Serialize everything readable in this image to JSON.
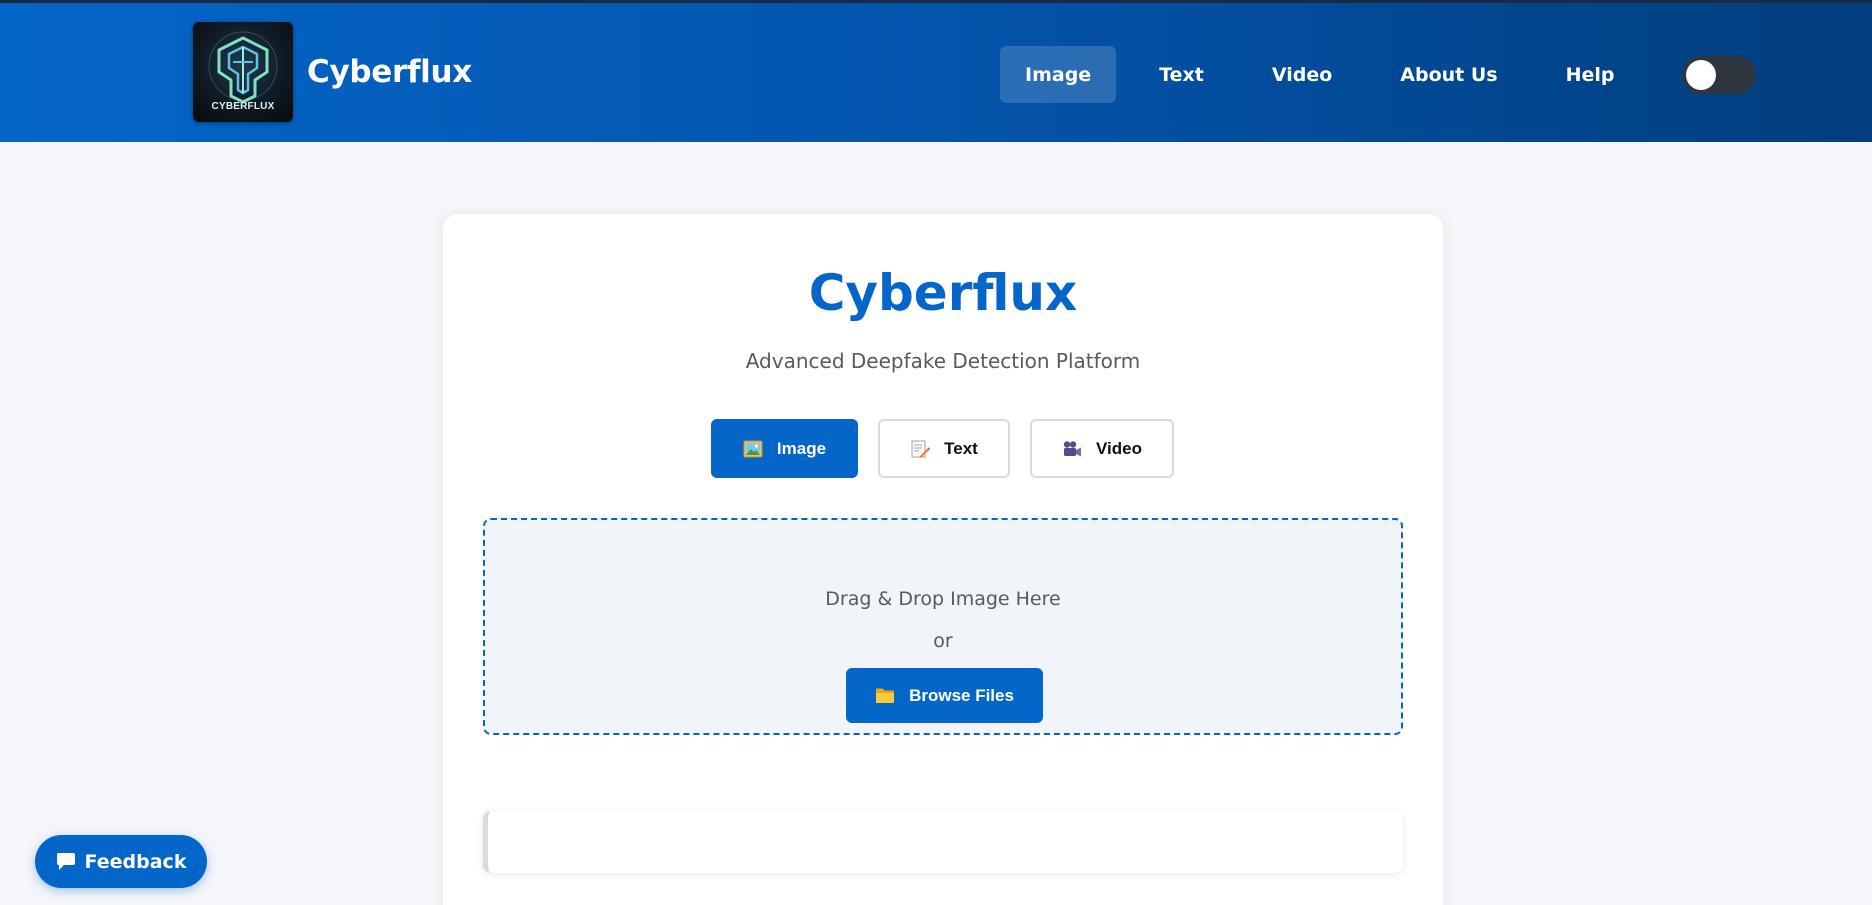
{
  "header": {
    "logo_text": "CYBERFLUX",
    "brand_name": "Cyberflux",
    "nav": [
      {
        "label": "Image",
        "active": true
      },
      {
        "label": "Text",
        "active": false
      },
      {
        "label": "Video",
        "active": false
      },
      {
        "label": "About Us",
        "active": false
      },
      {
        "label": "Help",
        "active": false
      }
    ],
    "theme_toggle": {
      "on": false
    }
  },
  "main": {
    "title": "Cyberflux",
    "subtitle": "Advanced Deepfake Detection Platform",
    "tabs": [
      {
        "label": "Image",
        "icon": "picture-icon",
        "active": true
      },
      {
        "label": "Text",
        "icon": "memo-icon",
        "active": false
      },
      {
        "label": "Video",
        "icon": "movie-camera-icon",
        "active": false
      }
    ],
    "dropzone": {
      "text": "Drag & Drop Image Here",
      "or": "or",
      "browse_label": "Browse Files",
      "browse_icon": "folder-icon"
    }
  },
  "feedback": {
    "label": "Feedback",
    "icon": "speech-bubble-icon"
  },
  "colors": {
    "primary": "#0466c8",
    "header_end": "#023e7d",
    "background": "#f4f6f9"
  }
}
